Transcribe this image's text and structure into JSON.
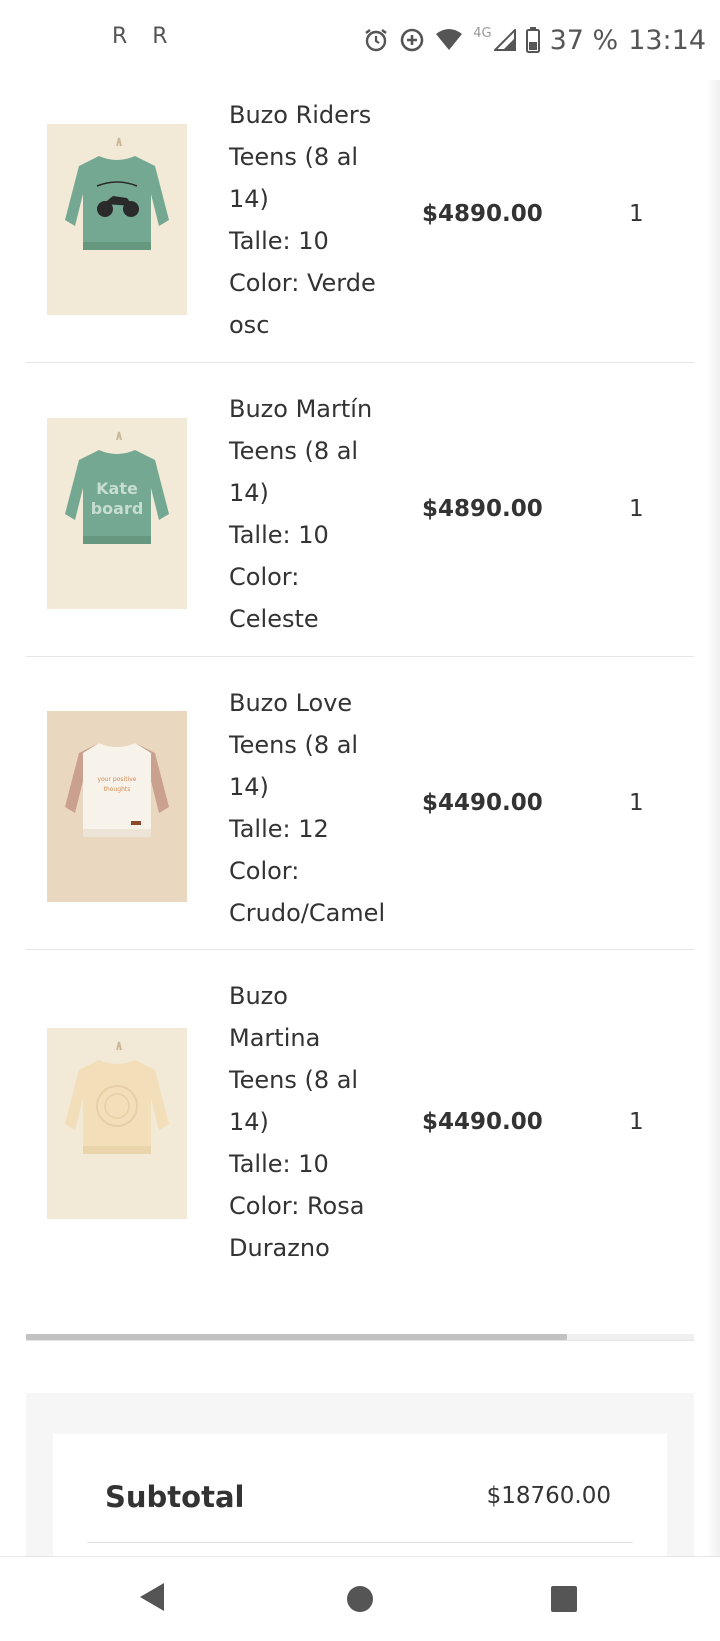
{
  "status_bar": {
    "left_icons": [
      "R",
      "R"
    ],
    "icons": [
      "alarm-icon",
      "data-saver-icon",
      "wifi-icon",
      "signal-icon",
      "battery-icon"
    ],
    "network": "4G",
    "battery": "37 %",
    "time": "13:14"
  },
  "cart": {
    "items": [
      {
        "name_lines": [
          "Buzo Riders",
          "Teens (8 al",
          "14)"
        ],
        "size": "Talle: 10",
        "color_lines": [
          "Color: Verde",
          "osc"
        ],
        "price": "$4890.00",
        "quantity": "1",
        "image": "green-moto-sweatshirt"
      },
      {
        "name_lines": [
          "Buzo Martín",
          "Teens (8 al",
          "14)"
        ],
        "size": "Talle: 10",
        "color_lines": [
          "Color:",
          "Celeste"
        ],
        "price": "$4890.00",
        "quantity": "1",
        "image": "green-print-sweatshirt"
      },
      {
        "name_lines": [
          "Buzo Love",
          "Teens (8 al",
          "14)"
        ],
        "size": "Talle: 12",
        "color_lines": [
          "Color:",
          "Crudo/Camel"
        ],
        "price": "$4490.00",
        "quantity": "1",
        "image": "cream-camel-sweatshirt"
      },
      {
        "name_lines": [
          "Buzo",
          "Martina",
          "Teens (8 al",
          "14)"
        ],
        "size": "Talle: 10",
        "color_lines": [
          "Color: Rosa",
          "Durazno"
        ],
        "price": "$4490.00",
        "quantity": "1",
        "image": "peach-sweatshirt"
      }
    ],
    "scroll_progress": 0.81
  },
  "summary": {
    "subtotal_label": "Subtotal",
    "subtotal_value": "$18760.00"
  },
  "nav": {
    "icons": [
      "back-icon",
      "home-icon",
      "recents-icon"
    ]
  },
  "colors": {
    "green_garment": "#74a892",
    "photo_bg": "#f2e9d6",
    "camel_bg": "#e9d7bf"
  }
}
